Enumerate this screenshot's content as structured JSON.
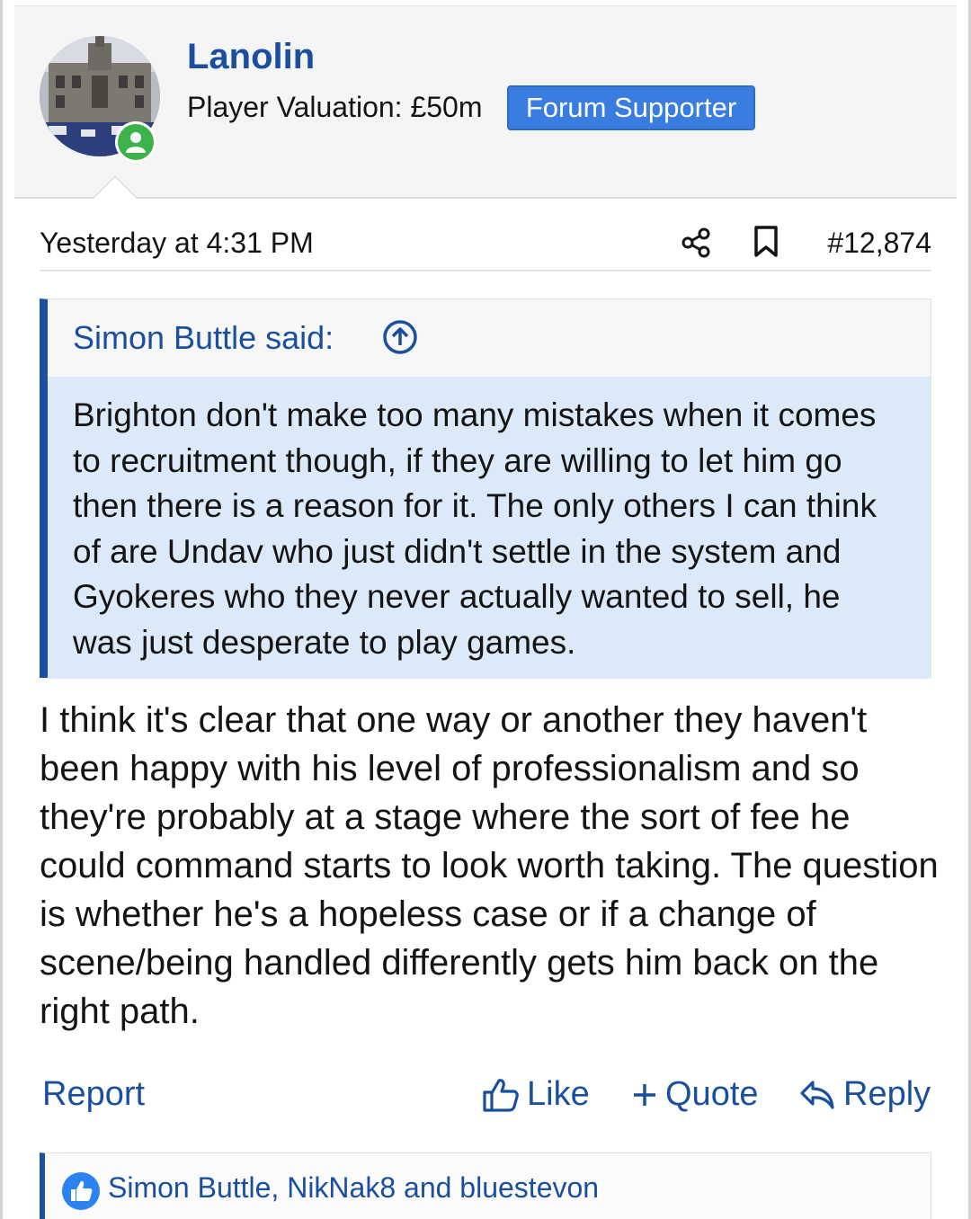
{
  "user": {
    "name": "Lanolin",
    "valuation": "Player Valuation: £50m",
    "badge": "Forum Supporter"
  },
  "post": {
    "timestamp": "Yesterday at 4:31 PM",
    "number": "#12,874",
    "icons": {
      "share": "share-icon",
      "bookmark": "bookmark-icon"
    }
  },
  "quote": {
    "author": "Simon Buttle said:",
    "body": "Brighton don't make too many mistakes when it comes to recruitment though, if they are willing to let him go then there is a reason for it. The only others I can think of are Undav who just didn't settle in the system and Gyokeres who they never actually wanted to sell, he was just desperate to play games."
  },
  "message": "I think it's clear that one way or another they haven't been happy with his level of professionalism and so they're probably at a stage where the sort of fee he could command starts to look worth taking. The question is whether he's a hopeless case or if a change of scene/being handled differently gets him back on the right path.",
  "actions": {
    "report": "Report",
    "like": "Like",
    "quote": "Quote",
    "reply": "Reply"
  },
  "reactions": {
    "text": "Simon Buttle, NikNak8 and bluestevon"
  },
  "colors": {
    "link": "#1a4fa0",
    "accent_bar": "#1d50a3",
    "badge": "#3a7de0",
    "quote_bg": "#dbe9f8",
    "online": "#3cb34a"
  }
}
